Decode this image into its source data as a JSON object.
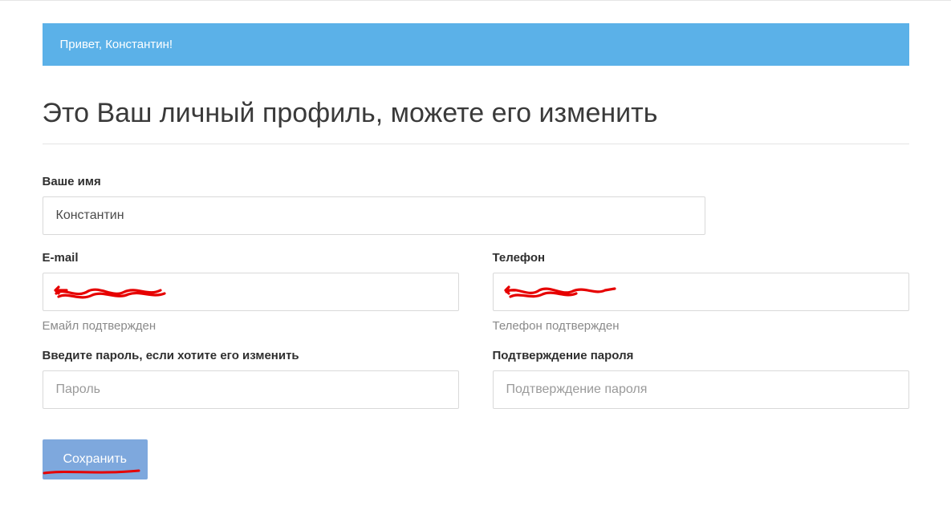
{
  "greeting": "Привет, Константин!",
  "page_title": "Это Ваш личный профиль, можете его изменить",
  "form": {
    "name": {
      "label": "Ваше имя",
      "value": "Константин"
    },
    "email": {
      "label": "E-mail",
      "value": "",
      "help": "Емайл подтвержден"
    },
    "phone": {
      "label": "Телефон",
      "value": "",
      "help": "Телефон подтвержден"
    },
    "password": {
      "label": "Введите пароль, если хотите его изменить",
      "placeholder": "Пароль"
    },
    "password_confirm": {
      "label": "Подтверждение пароля",
      "placeholder": "Подтверждение пароля"
    },
    "save_label": "Сохранить"
  },
  "colors": {
    "banner": "#5bb1e8",
    "button": "#7ea8dd",
    "text_muted": "#8a8a8a",
    "annotation_red": "#e60000"
  }
}
